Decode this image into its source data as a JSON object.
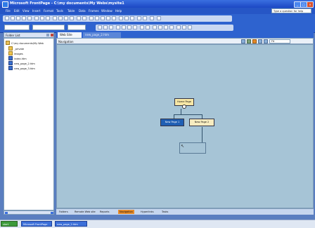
{
  "window": {
    "title": "Microsoft FrontPage - C:\\my documents\\My Webs\\mysite1",
    "help_placeholder": "Type a question for help"
  },
  "menu": [
    "File",
    "Edit",
    "View",
    "Insert",
    "Format",
    "Tools",
    "Table",
    "Data",
    "Frames",
    "Window",
    "Help"
  ],
  "folder_list": {
    "title": "Folder List",
    "items": [
      {
        "label": "C:\\my documents\\My Web",
        "icon": "web-folder-icon"
      },
      {
        "label": "_private",
        "icon": "folder-icon"
      },
      {
        "label": "images",
        "icon": "folder-icon"
      },
      {
        "label": "index.htm",
        "icon": "page-icon"
      },
      {
        "label": "new_page_2.htm",
        "icon": "page-icon"
      },
      {
        "label": "new_page_3.htm",
        "icon": "page-icon"
      }
    ]
  },
  "tabs": [
    {
      "label": "Web Site",
      "active": true
    },
    {
      "label": "new_page_2.htm",
      "active": false
    }
  ],
  "navigation": {
    "title": "Navigation",
    "zoom": "Fit",
    "nodes": {
      "home": "Home Page",
      "child1": "New Page 1",
      "child2": "New Page 2"
    }
  },
  "views": [
    "Folders",
    "Remote Web site",
    "Reports",
    "Navigation",
    "Hyperlinks",
    "Tasks"
  ],
  "colors": {
    "title_bar": "#2656c6",
    "canvas": "#a6c4d6",
    "node_home": "#f7e7a6",
    "node_selected": "#1f5fb4",
    "node_child": "#f7ecc0",
    "view_active": "#e58a2a"
  },
  "taskbar": {
    "start": "start",
    "tasks": [
      "Microsoft FrontPage",
      "new_page_2.htm"
    ]
  }
}
